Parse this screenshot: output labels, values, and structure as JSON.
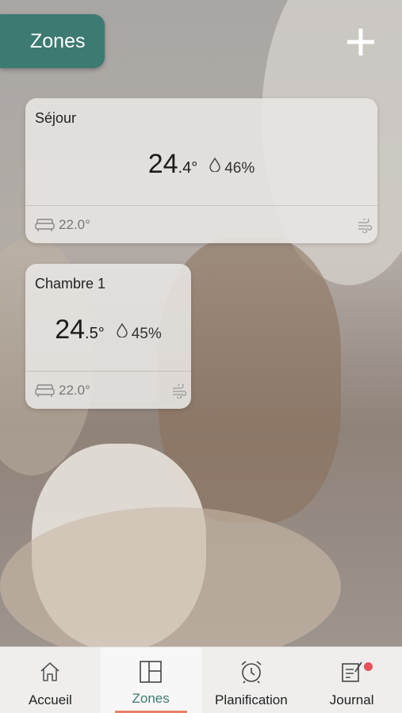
{
  "header": {
    "title": "Zones"
  },
  "zones": [
    {
      "name": "Séjour",
      "temp_int": "24",
      "temp_dec": ".4°",
      "humidity": "46%",
      "setpoint": "22.0°"
    },
    {
      "name": "Chambre 1",
      "temp_int": "24",
      "temp_dec": ".5°",
      "humidity": "45%",
      "setpoint": "22.0°"
    }
  ],
  "nav": {
    "items": [
      {
        "label": "Accueil",
        "icon": "home-icon"
      },
      {
        "label": "Zones",
        "icon": "zones-grid-icon",
        "active": true
      },
      {
        "label": "Planification",
        "icon": "alarm-clock-icon"
      },
      {
        "label": "Journal",
        "icon": "journal-edit-icon",
        "badge": true
      }
    ]
  },
  "colors": {
    "accent": "#3d7a72",
    "indicator": "#e8836a",
    "badge": "#e8505b"
  }
}
